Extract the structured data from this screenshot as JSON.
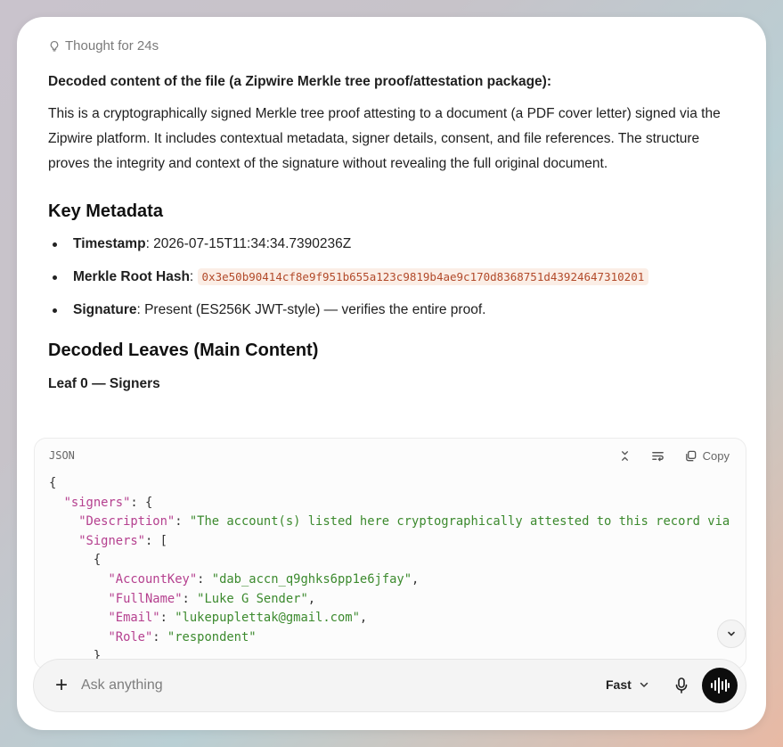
{
  "thought": {
    "label": "Thought for 24s"
  },
  "message": {
    "intro_heading": "Decoded content of the file (a Zipwire Merkle tree proof/attestation package):",
    "intro_paragraph": "This is a cryptographically signed Merkle tree proof attesting to a document (a PDF cover letter) signed via the Zipwire platform. It includes contextual metadata, signer details, consent, and file references. The structure proves the integrity and context of the signature without revealing the full original document.",
    "key_metadata_heading": "Key Metadata",
    "metadata": [
      {
        "label": "Timestamp",
        "value": ": 2026-07-15T11:34:34.7390236Z"
      },
      {
        "label": "Merkle Root Hash",
        "sep": ": ",
        "code": "0x3e50b90414cf8e9f951b655a123c9819b4ae9c170d8368751d43924647310201"
      },
      {
        "label": "Signature",
        "value": ": Present (ES256K JWT-style) — verifies the entire proof."
      }
    ],
    "leaves_heading": "Decoded Leaves (Main Content)",
    "leaf0_heading": "Leaf 0 — Signers"
  },
  "codeblock": {
    "language": "JSON",
    "copy_label": "Copy",
    "lines": [
      [
        [
          "p",
          "{"
        ]
      ],
      [
        [
          "p",
          "  "
        ],
        [
          "k",
          "\"signers\""
        ],
        [
          "p",
          ": {"
        ]
      ],
      [
        [
          "p",
          "    "
        ],
        [
          "k",
          "\"Description\""
        ],
        [
          "p",
          ": "
        ],
        [
          "s",
          "\"The account(s) listed here cryptographically attested to this record via"
        ]
      ],
      [
        [
          "p",
          "    "
        ],
        [
          "k",
          "\"Signers\""
        ],
        [
          "p",
          ": ["
        ]
      ],
      [
        [
          "p",
          "      {"
        ]
      ],
      [
        [
          "p",
          "        "
        ],
        [
          "k",
          "\"AccountKey\""
        ],
        [
          "p",
          ": "
        ],
        [
          "s",
          "\"dab_accn_q9ghks6pp1e6jfay\""
        ],
        [
          "p",
          ","
        ]
      ],
      [
        [
          "p",
          "        "
        ],
        [
          "k",
          "\"FullName\""
        ],
        [
          "p",
          ": "
        ],
        [
          "s",
          "\"Luke G Sender\""
        ],
        [
          "p",
          ","
        ]
      ],
      [
        [
          "p",
          "        "
        ],
        [
          "k",
          "\"Email\""
        ],
        [
          "p",
          ": "
        ],
        [
          "s",
          "\"lukepuplettak@gmail.com\""
        ],
        [
          "p",
          ","
        ]
      ],
      [
        [
          "p",
          "        "
        ],
        [
          "k",
          "\"Role\""
        ],
        [
          "p",
          ": "
        ],
        [
          "s",
          "\"respondent\""
        ]
      ],
      [
        [
          "p",
          "      }"
        ]
      ]
    ]
  },
  "composer": {
    "placeholder": "Ask anything",
    "mode": "Fast"
  }
}
